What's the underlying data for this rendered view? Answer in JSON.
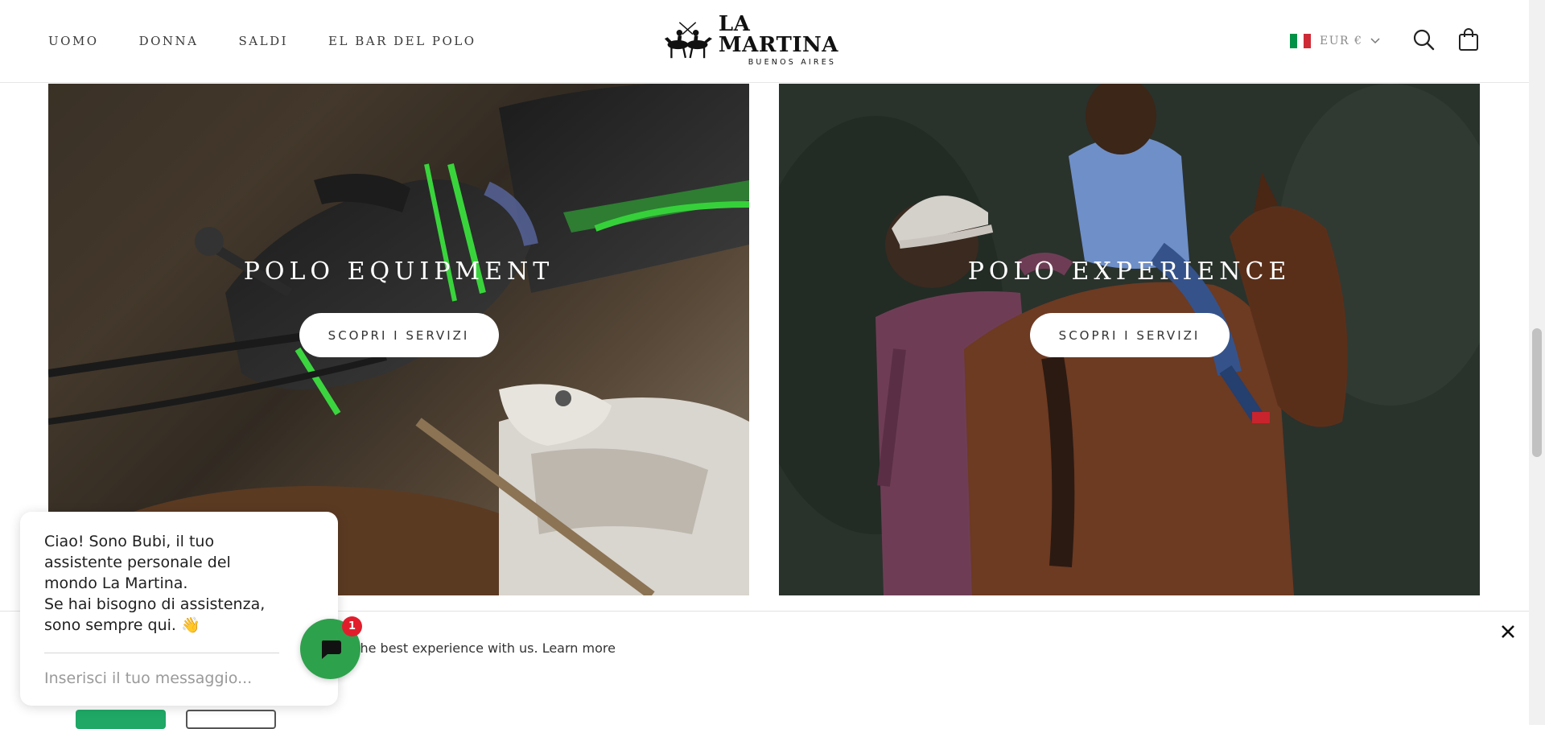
{
  "header": {
    "nav": [
      "UOMO",
      "DONNA",
      "SALDI",
      "EL BAR DEL POLO"
    ],
    "logo": {
      "word": "LA MARTINA",
      "sub": "BUENOS AIRES"
    },
    "currency": "EUR €",
    "flag_colors": [
      "#009246",
      "#ffffff",
      "#ce2b37"
    ]
  },
  "tiles": [
    {
      "title": "POLO EQUIPMENT",
      "button": "SCOPRI I SERVIZI"
    },
    {
      "title": "POLO EXPERIENCE",
      "button": "SCOPRI I SERVIZI"
    }
  ],
  "cookie": {
    "text": "et the best experience with us.",
    "link": "Learn more",
    "accept_color": "#1fa866"
  },
  "chat": {
    "lines": [
      "Ciao! Sono Bubi, il tuo",
      "assistente personale del",
      "mondo La Martina.",
      "Se hai bisogno di assistenza,",
      "sono sempre qui. 👋"
    ],
    "placeholder": "Inserisci il tuo messaggio...",
    "badge": "1",
    "fab_color": "#2da14c"
  },
  "icons": [
    "logo-mark-icon",
    "chevron-down-icon",
    "search-icon",
    "bag-icon",
    "close-icon",
    "chat-bubble-icon"
  ]
}
